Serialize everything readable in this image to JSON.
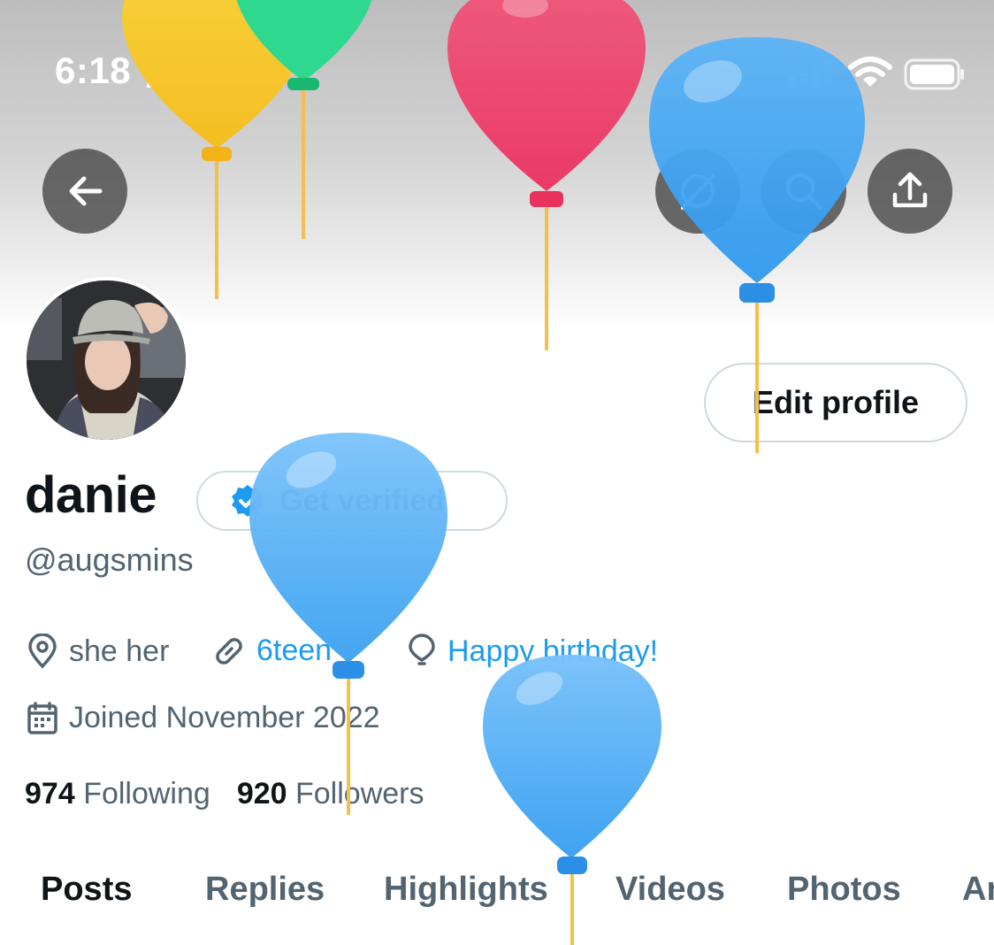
{
  "status_bar": {
    "time": "6:18"
  },
  "profile": {
    "display_name": "danie",
    "handle": "@augsmins",
    "bio_items": {
      "pronouns": "she her",
      "link": "6teen",
      "birthday": "Happy birthday!",
      "joined": "Joined November 2022"
    },
    "following_count": "974",
    "following_label": "Following",
    "followers_count": "920",
    "followers_label": "Followers"
  },
  "buttons": {
    "edit_profile": "Edit profile",
    "get_verified": "Get verified"
  },
  "tabs": [
    {
      "label": "Posts",
      "active": true
    },
    {
      "label": "Replies",
      "active": false
    },
    {
      "label": "Highlights",
      "active": false
    },
    {
      "label": "Videos",
      "active": false
    },
    {
      "label": "Photos",
      "active": false
    },
    {
      "label": "Ar",
      "active": false
    }
  ],
  "colors": {
    "accent": "#1d9bf0",
    "secondary_text": "#536471",
    "primary_text": "#0f1419",
    "balloon_blue": "#4aa9f5",
    "balloon_red": "#ef4f77",
    "balloon_yellow": "#f6c32b",
    "balloon_green": "#2fd88f"
  },
  "icons": {
    "back": "arrow-left-icon",
    "grok": "grok-icon",
    "search": "search-icon",
    "share": "share-icon",
    "location": "location-pin-icon",
    "link": "link-icon",
    "birthday": "balloon-icon",
    "calendar": "calendar-icon",
    "verified": "verified-badge-icon"
  }
}
